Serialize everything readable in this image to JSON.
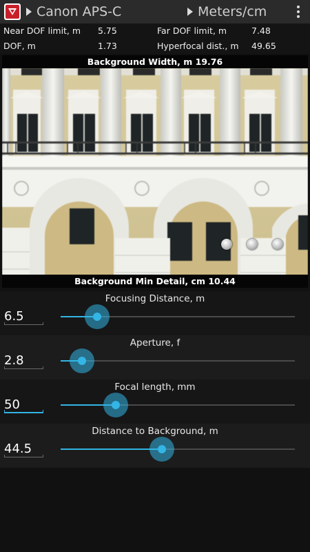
{
  "toolbar": {
    "camera": "Canon APS-C",
    "units": "Meters/cm"
  },
  "results": {
    "near_label": "Near DOF limit, m",
    "near_value": "5.75",
    "far_label": "Far DOF limit, m",
    "far_value": "7.48",
    "dof_label": "DOF, m",
    "dof_value": "1.73",
    "hyper_label": "Hyperfocal dist., m",
    "hyper_value": "49.65"
  },
  "preview": {
    "background_width": "Background Width, m  19.76",
    "background_min_detail": "Background Min Detail, cm   10.44"
  },
  "sliders": [
    {
      "title": "Focusing Distance, m",
      "value": "6.5",
      "fraction": 0.155,
      "active": false
    },
    {
      "title": "Aperture, f",
      "value": "2.8",
      "fraction": 0.09,
      "active": false
    },
    {
      "title": "Focal length, mm",
      "value": "50",
      "fraction": 0.235,
      "active": true
    },
    {
      "title": "Distance to Background, m",
      "value": "44.5",
      "fraction": 0.432,
      "active": false
    }
  ],
  "colors": {
    "accent": "#33b5e5",
    "app_icon": "#c8202a"
  },
  "icons": {
    "app": "app-logo-icon",
    "dropdown": "triangle-right-icon",
    "menu": "overflow-menu-icon"
  }
}
